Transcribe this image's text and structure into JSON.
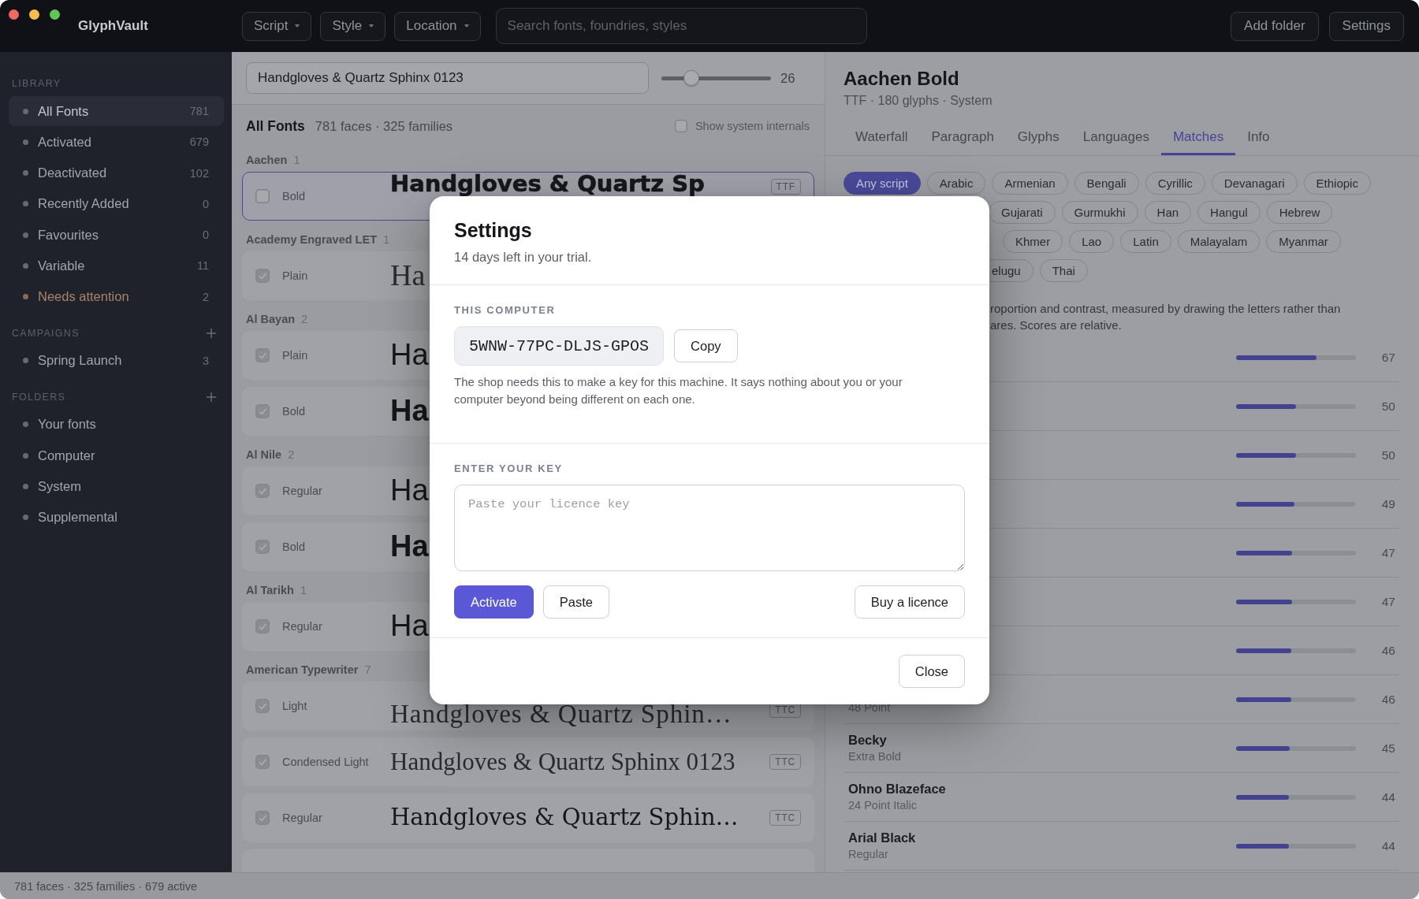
{
  "window": {
    "title": "GlyphVault"
  },
  "toolbar": {
    "filters": [
      {
        "label": "Script"
      },
      {
        "label": "Style"
      },
      {
        "label": "Location"
      }
    ],
    "search": {
      "placeholder": "Search fonts, foundries, styles"
    },
    "buttons": [
      {
        "label": "Add folder"
      },
      {
        "label": "Settings"
      }
    ]
  },
  "sidebar": {
    "sections": [
      {
        "title": "LIBRARY",
        "items": [
          {
            "label": "All Fonts",
            "count": "781",
            "selected": true,
            "kind": "normal"
          },
          {
            "label": "Activated",
            "count": "679",
            "selected": false,
            "kind": "normal"
          },
          {
            "label": "Deactivated",
            "count": "102",
            "selected": false,
            "kind": "normal"
          },
          {
            "label": "Recently Added",
            "count": "0",
            "selected": false,
            "kind": "normal"
          },
          {
            "label": "Favourites",
            "count": "0",
            "selected": false,
            "kind": "normal"
          },
          {
            "label": "Variable",
            "count": "11",
            "selected": false,
            "kind": "normal"
          },
          {
            "label": "Needs attention",
            "count": "2",
            "selected": false,
            "kind": "warning"
          }
        ]
      },
      {
        "title": "CAMPAIGNS",
        "addable": true,
        "items": [
          {
            "label": "Spring Launch",
            "count": "3",
            "selected": false,
            "kind": "normal"
          }
        ]
      },
      {
        "title": "FOLDERS",
        "addable": true,
        "items": [
          {
            "label": "Your fonts",
            "selected": false,
            "kind": "normal"
          },
          {
            "label": "Computer",
            "selected": false,
            "kind": "normal"
          },
          {
            "label": "System",
            "selected": false,
            "kind": "normal"
          },
          {
            "label": "Supplemental",
            "selected": false,
            "kind": "normal"
          }
        ]
      }
    ]
  },
  "preview": {
    "text": "Handgloves & Quartz Sphinx 0123",
    "size": {
      "level": 0.27,
      "reading": "26"
    }
  },
  "list_header": {
    "title": "All Fonts",
    "summary": "781 faces · 325 families",
    "toggle": {
      "label": "Show system internals",
      "checked": false
    }
  },
  "families": [
    {
      "name": "Aachen",
      "count": "1",
      "faces": [
        {
          "style": "Bold",
          "checked": false,
          "selected": true,
          "kind": "slab-black",
          "preview": "Handgloves & Quartz Sp",
          "format": "TTF"
        }
      ]
    },
    {
      "name": "Academy Engraved LET",
      "count": "1",
      "faces": [
        {
          "style": "Plain",
          "checked": true,
          "selected": false,
          "kind": "engraved",
          "preview": "Ha"
        }
      ]
    },
    {
      "name": "Al Bayan",
      "count": "2",
      "faces": [
        {
          "style": "Plain",
          "checked": true,
          "selected": false,
          "kind": "sans",
          "preview": "Ha"
        },
        {
          "style": "Bold",
          "checked": true,
          "selected": false,
          "kind": "sans-bold",
          "preview": "Ha"
        }
      ]
    },
    {
      "name": "Al Nile",
      "count": "2",
      "faces": [
        {
          "style": "Regular",
          "checked": true,
          "selected": false,
          "kind": "sans",
          "preview": "Ha"
        },
        {
          "style": "Bold",
          "checked": true,
          "selected": false,
          "kind": "sans-bold",
          "preview": "Ha"
        }
      ]
    },
    {
      "name": "Al Tarikh",
      "count": "1",
      "faces": [
        {
          "style": "Regular",
          "checked": true,
          "selected": false,
          "kind": "sans",
          "preview": "Ha"
        }
      ]
    },
    {
      "name": "American Typewriter",
      "count": "7",
      "faces": [
        {
          "style": "Light",
          "checked": true,
          "selected": false,
          "kind": "typewriter-light",
          "preview": "Handgloves & Quartz Sphin…",
          "format": "TTC"
        },
        {
          "style": "Condensed Light",
          "checked": true,
          "selected": false,
          "kind": "typewriter-condensed",
          "preview": "Handgloves & Quartz Sphinx 0123",
          "format": "TTC"
        },
        {
          "style": "Regular",
          "checked": true,
          "selected": false,
          "kind": "typewriter",
          "preview": "Handgloves & Quartz Sphin…",
          "format": "TTC"
        },
        {
          "selected": false
        }
      ]
    }
  ],
  "detail": {
    "title": "Aachen Bold",
    "meta": "TTF · 180 glyphs · System",
    "tabs": [
      {
        "label": "Waterfall",
        "selected": false
      },
      {
        "label": "Paragraph",
        "selected": false
      },
      {
        "label": "Glyphs",
        "selected": false
      },
      {
        "label": "Languages",
        "selected": false
      },
      {
        "label": "Matches",
        "selected": true
      },
      {
        "label": "Info",
        "selected": false
      }
    ],
    "script_chips": [
      [
        {
          "label": "Any script",
          "selected": true
        },
        {
          "label": "Arabic",
          "selected": false
        },
        {
          "label": "Armenian",
          "selected": false
        },
        {
          "label": "Bengali",
          "selected": false
        },
        {
          "label": "Cyrillic",
          "selected": false
        },
        {
          "label": "Devanagari",
          "selected": false
        },
        {
          "label": "Ethiopic",
          "selected": false
        }
      ],
      [
        {
          "label": "Gujarati",
          "selected": false
        },
        {
          "label": "Gurmukhi",
          "selected": false
        },
        {
          "label": "Han",
          "selected": false
        },
        {
          "label": "Hangul",
          "selected": false
        },
        {
          "label": "Hebrew",
          "selected": false
        }
      ],
      [
        {
          "label": "Khmer",
          "selected": false
        },
        {
          "label": "Lao",
          "selected": false
        },
        {
          "label": "Latin",
          "selected": false
        },
        {
          "label": "Malayalam",
          "selected": false
        },
        {
          "label": "Myanmar",
          "selected": false
        }
      ],
      [
        {
          "label": "elugu",
          "selected": false
        },
        {
          "label": "Thai",
          "selected": false
        }
      ]
    ],
    "description_lines": [
      "roportion and contrast, measured by drawing the letters rather than",
      "ares. Scores are relative."
    ],
    "matches": [
      {
        "score": "67",
        "level": 0.67
      },
      {
        "score": "50",
        "level": 0.5
      },
      {
        "score": "50",
        "level": 0.5
      },
      {
        "score": "49",
        "level": 0.49
      },
      {
        "score": "47",
        "level": 0.47
      },
      {
        "score": "47",
        "level": 0.47
      },
      {
        "score": "46",
        "level": 0.46
      },
      {
        "style": "48 Point",
        "score": "46",
        "level": 0.46
      },
      {
        "name": "Becky",
        "style": "Extra Bold",
        "score": "45",
        "level": 0.45
      },
      {
        "name": "Ohno Blazeface",
        "style": "24 Point Italic",
        "score": "44",
        "level": 0.44
      },
      {
        "name": "Arial Black",
        "style": "Regular",
        "score": "44",
        "level": 0.44
      }
    ]
  },
  "dialog": {
    "title": "Settings",
    "subtitle": "14 days left in your trial.",
    "machine": {
      "heading": "THIS COMPUTER",
      "code": "5WNW-77PC-DLJS-GPOS",
      "copy_label": "Copy",
      "note": "The shop needs this to make a key for this machine. It says nothing about you or your computer beyond being different on each one."
    },
    "key_entry": {
      "heading": "ENTER YOUR KEY",
      "placeholder": "Paste your licence key",
      "actions": [
        {
          "label": "Activate",
          "kind": "primary"
        },
        {
          "label": "Paste",
          "kind": "secondary"
        },
        {
          "label": "Buy a licence",
          "kind": "secondary"
        }
      ]
    },
    "close_label": "Close"
  },
  "status_bar": {
    "text": "781 faces · 325 families · 679 active"
  }
}
